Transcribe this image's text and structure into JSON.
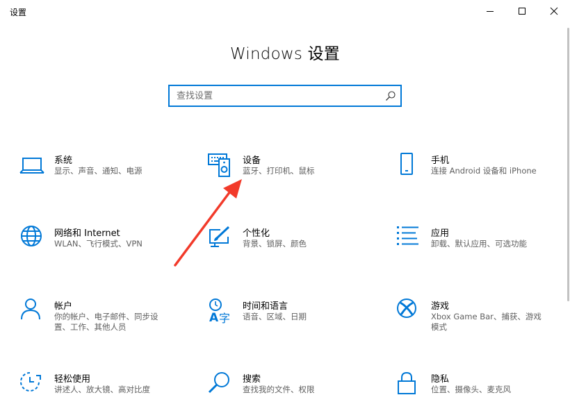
{
  "window": {
    "title": "设置",
    "controls": [
      "minimize-icon",
      "maximize-icon",
      "close-icon"
    ]
  },
  "header": {
    "title": "Windows 设置"
  },
  "search": {
    "placeholder": "查找设置",
    "value": "",
    "icon": "search-icon"
  },
  "accent_color": "#0078d7",
  "tiles": [
    {
      "id": "system",
      "title": "系统",
      "desc": "显示、声音、通知、电源",
      "icon": "laptop-icon"
    },
    {
      "id": "devices",
      "title": "设备",
      "desc": "蓝牙、打印机、鼠标",
      "icon": "devices-icon"
    },
    {
      "id": "phone",
      "title": "手机",
      "desc": "连接 Android 设备和 iPhone",
      "icon": "phone-icon"
    },
    {
      "id": "network",
      "title": "网络和 Internet",
      "desc": "WLAN、飞行模式、VPN",
      "icon": "globe-icon"
    },
    {
      "id": "personalization",
      "title": "个性化",
      "desc": "背景、锁屏、颜色",
      "icon": "paintbrush-icon"
    },
    {
      "id": "apps",
      "title": "应用",
      "desc": "卸载、默认应用、可选功能",
      "icon": "apps-list-icon"
    },
    {
      "id": "accounts",
      "title": "帐户",
      "desc": "你的帐户、电子邮件、同步设置、工作、其他人员",
      "icon": "person-icon"
    },
    {
      "id": "time-language",
      "title": "时间和语言",
      "desc": "语音、区域、日期",
      "icon": "time-language-icon"
    },
    {
      "id": "gaming",
      "title": "游戏",
      "desc": "Xbox Game Bar、捕获、游戏模式",
      "icon": "xbox-icon"
    },
    {
      "id": "ease-of-access",
      "title": "轻松使用",
      "desc": "讲述人、放大镜、高对比度",
      "icon": "ease-of-access-icon"
    },
    {
      "id": "search",
      "title": "搜索",
      "desc": "查找我的文件、权限",
      "icon": "magnifier-icon"
    },
    {
      "id": "privacy",
      "title": "隐私",
      "desc": "位置、摄像头、麦克风",
      "icon": "lock-icon"
    }
  ]
}
